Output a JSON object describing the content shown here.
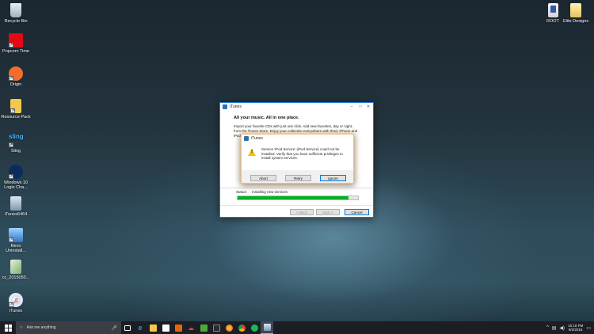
{
  "desktop_left": [
    {
      "label": "Recycle Bin"
    },
    {
      "label": "Popcorn Time"
    },
    {
      "label": "Origin"
    },
    {
      "label": "Resource Pack"
    },
    {
      "label": "Sling"
    },
    {
      "label": "Windows 10 Login Cha..."
    },
    {
      "label": "iTunes6464"
    },
    {
      "label": "Revo Uninstall..."
    },
    {
      "label": "cc_2015050..."
    },
    {
      "label": "iTunes"
    }
  ],
  "desktop_right": [
    {
      "label": "ROOT"
    },
    {
      "label": "Elite Designs"
    }
  ],
  "installer": {
    "title": "iTunes",
    "heading": "All your music. All in one place.",
    "body_line1": "Import your favorite CDs with just one click.  Add new favorites, day or night,",
    "body_line2": "from the iTunes Store. Enjoy your collection everywhere with iPod, iPhone and",
    "body_line3": "iPad.",
    "status_label": "Status:",
    "status_value": "Installing new services",
    "progress": 0.92,
    "back_label": "< Back",
    "next_label": "Next >",
    "cancel_label": "Cancel"
  },
  "dialog": {
    "title": "iTunes",
    "message_line1": "Service 'iPod Service' (iPod Service) could not be",
    "message_line2": "installed.  Verify that you have sufficient privileges to",
    "message_line3": "install system services.",
    "abort_label": "Abort",
    "retry_label": "Retry",
    "ignore_label": "Ignore"
  },
  "taskbar": {
    "search_placeholder": "Ask me anything",
    "time": "10:18 PM",
    "date": "9/2/2015"
  }
}
